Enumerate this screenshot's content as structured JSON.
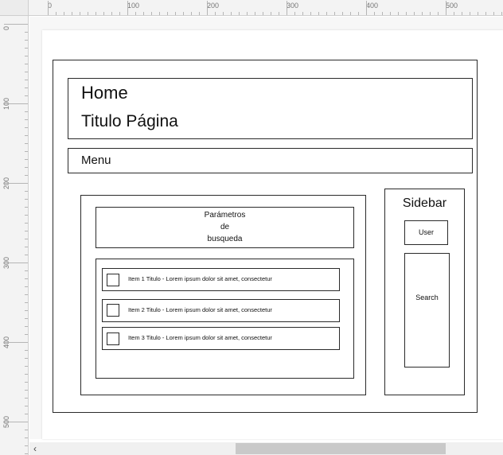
{
  "ruler": {
    "x_labels": [
      "0",
      "100",
      "200",
      "300",
      "400",
      "500"
    ],
    "y_labels": [
      "0",
      "100",
      "200",
      "300",
      "400",
      "500"
    ]
  },
  "scroll": {
    "left_arrow": "‹"
  },
  "wireframe": {
    "header": {
      "home": "Home",
      "page_title": "Titulo Página"
    },
    "menu": {
      "label": "Menu"
    },
    "search_params": {
      "line1": "Parámetros",
      "line2": "de",
      "line3": "busqueda"
    },
    "items": [
      {
        "label": "Item 1 Titulo - Lorem ipsum dolor sit amet, consectetur"
      },
      {
        "label": "Item 2 Titulo - Lorem ipsum dolor sit amet, consectetur"
      },
      {
        "label": "Item 3 Titulo - Lorem ipsum dolor sit amet, consectetur"
      }
    ],
    "sidebar": {
      "title": "Sidebar",
      "user": "User",
      "search": "Search"
    }
  }
}
